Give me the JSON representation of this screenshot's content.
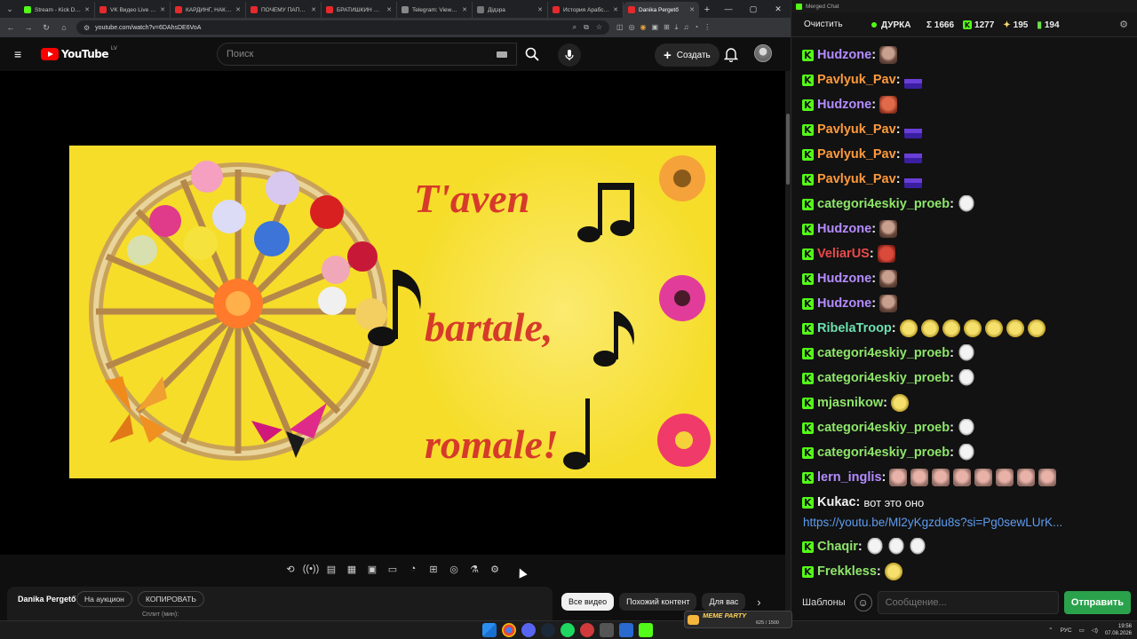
{
  "browser": {
    "tabs": [
      {
        "title": "Stream - Kick Dash",
        "icon_color": "#53fc18",
        "active": false
      },
      {
        "title": "VK Видео Live — ...",
        "icon_color": "#e6292c",
        "active": false
      },
      {
        "title": "КАРДИНГ, НАКРУ...",
        "icon_color": "#e6292c",
        "active": false
      },
      {
        "title": "ПОЧЕМУ ПАПА Т...",
        "icon_color": "#e6292c",
        "active": false
      },
      {
        "title": "БРАТИШКИН СО...",
        "icon_color": "#e6292c",
        "active": false
      },
      {
        "title": "Telegram: View @...",
        "icon_color": "#888888",
        "active": false
      },
      {
        "title": "Дідзра",
        "icon_color": "#777777",
        "active": false
      },
      {
        "title": "История Арабск...",
        "icon_color": "#e6292c",
        "active": false
      },
      {
        "title": "Danika Pergető",
        "icon_color": "#e6292c",
        "active": true
      }
    ],
    "new_tab": "+",
    "url": "youtube.com/watch?v=6DAhsDE6VoA"
  },
  "youtube": {
    "logo_text": "YouTube",
    "country": "LV",
    "search_placeholder": "Поиск",
    "create_label": "Создать",
    "streamer_name": "Danika Pergető",
    "auction_label": "На аукцион",
    "copy_label": "КОПИРОВАТЬ",
    "split_label": "Сплит (мин):",
    "chips": [
      "Все видео",
      "Похожий контент",
      "Для вас"
    ]
  },
  "video": {
    "line1": "T'aven",
    "line2": "bartale,",
    "line3": "romale!",
    "bg_color": "#f6dd2a",
    "text_color": "#d63a2a"
  },
  "chat": {
    "window_title": "Merged Chat",
    "clear_label": "Очистить",
    "channel": "ДУРКА",
    "total": "Σ 1666",
    "kick_count": "1277",
    "sparkle_count": "195",
    "green_count": "194",
    "templates_label": "Шаблоны",
    "input_placeholder": "Сообщение...",
    "send_label": "Отправить",
    "messages": [
      {
        "user": "Hudzone",
        "color": "#b48cff",
        "text": "",
        "emotes": [
          "face"
        ]
      },
      {
        "user": "Pavlyuk_Pav",
        "color": "#ff9a3c",
        "text": "",
        "emotes": [
          "wave"
        ]
      },
      {
        "user": "Hudzone",
        "color": "#b48cff",
        "text": "",
        "emotes": [
          "red"
        ]
      },
      {
        "user": "Pavlyuk_Pav",
        "color": "#ff9a3c",
        "text": "",
        "emotes": [
          "wave"
        ]
      },
      {
        "user": "Pavlyuk_Pav",
        "color": "#ff9a3c",
        "text": "",
        "emotes": [
          "wave"
        ]
      },
      {
        "user": "Pavlyuk_Pav",
        "color": "#ff9a3c",
        "text": "",
        "emotes": [
          "wave"
        ]
      },
      {
        "user": "categori4eskiy_proeb",
        "color": "#8ee66a",
        "text": "",
        "emotes": [
          "ghost"
        ]
      },
      {
        "user": "Hudzone",
        "color": "#b48cff",
        "text": "",
        "emotes": [
          "face"
        ]
      },
      {
        "user": "VeliarUS",
        "color": "#e84a4a",
        "text": "",
        "emotes": [
          "bag"
        ]
      },
      {
        "user": "Hudzone",
        "color": "#b48cff",
        "text": "",
        "emotes": [
          "face"
        ]
      },
      {
        "user": "Hudzone",
        "color": "#b48cff",
        "text": "",
        "emotes": [
          "face"
        ]
      },
      {
        "user": "RibelaTroop",
        "color": "#6ee0b0",
        "text": "",
        "emotes": [
          "yellow",
          "yellow",
          "yellow",
          "yellow",
          "yellow",
          "yellow",
          "yellow"
        ]
      },
      {
        "user": "categori4eskiy_proeb",
        "color": "#8ee66a",
        "text": "",
        "emotes": [
          "ghost"
        ]
      },
      {
        "user": "categori4eskiy_proeb",
        "color": "#8ee66a",
        "text": "",
        "emotes": [
          "ghost"
        ]
      },
      {
        "user": "mjasnikow",
        "color": "#8ee66a",
        "text": "",
        "emotes": [
          "yellow"
        ]
      },
      {
        "user": "categori4eskiy_proeb",
        "color": "#8ee66a",
        "text": "",
        "emotes": [
          "ghost"
        ]
      },
      {
        "user": "categori4eskiy_proeb",
        "color": "#8ee66a",
        "text": "",
        "emotes": [
          "ghost"
        ]
      },
      {
        "user": "lern_inglis",
        "color": "#b48cff",
        "text": "",
        "emotes": [
          "pink",
          "pink",
          "pink",
          "pink",
          "pink",
          "pink",
          "pink",
          "pink"
        ]
      },
      {
        "user": "Kukac",
        "color": "#f2f2f2",
        "text": "вот  это оно",
        "emotes": []
      },
      {
        "user": "Chaqir",
        "color": "#8ee66a",
        "text": "",
        "emotes": [
          "ghost",
          "ghost",
          "ghost"
        ]
      },
      {
        "user": "Frekkless",
        "color": "#8ee66a",
        "text": "",
        "emotes": [
          "yellow"
        ]
      }
    ],
    "link": "https://youtu.be/Ml2yKgzdu8s?si=Pg0sewLUrK..."
  },
  "taskbar": {
    "meme_label": "MEME PARTY",
    "meme_count": "625 / 1500",
    "lang": "РУС",
    "time": "19:56",
    "date": "07.08.2026"
  }
}
